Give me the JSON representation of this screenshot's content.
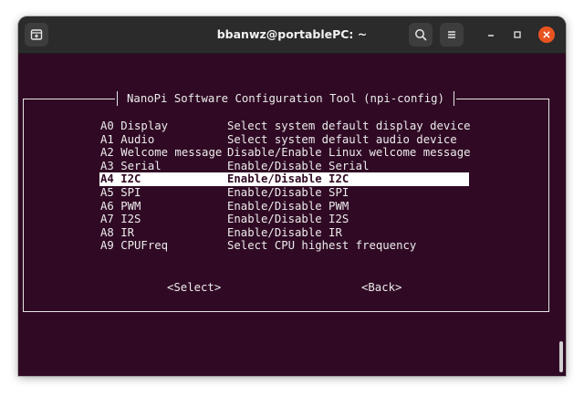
{
  "window": {
    "title": "bbanwz@portablePC: ~"
  },
  "titlebar": {
    "new_tab_icon": "new-tab-icon",
    "search_icon": "search-icon",
    "menu_icon": "hamburger-menu-icon",
    "minimize_icon": "minimize-icon",
    "maximize_icon": "maximize-icon",
    "close_icon": "close-icon"
  },
  "dialog": {
    "title": "NanoPi Software Configuration Tool (npi-config)",
    "items": [
      {
        "key": "A0 Display",
        "desc": "Select system default display device"
      },
      {
        "key": "A1 Audio",
        "desc": "Select system default audio device"
      },
      {
        "key": "A2 Welcome message",
        "desc": "Disable/Enable Linux welcome message"
      },
      {
        "key": "A3 Serial",
        "desc": "Enable/Disable Serial"
      },
      {
        "key": "A4 I2C",
        "desc": "Enable/Disable I2C"
      },
      {
        "key": "A5 SPI",
        "desc": "Enable/Disable SPI"
      },
      {
        "key": "A6 PWM",
        "desc": "Enable/Disable PWM"
      },
      {
        "key": "A7 I2S",
        "desc": "Enable/Disable I2S"
      },
      {
        "key": "A8 IR",
        "desc": "Enable/Disable IR"
      },
      {
        "key": "A9 CPUFreq",
        "desc": "Select CPU highest frequency"
      }
    ],
    "select_label": "<Select>",
    "back_label": "<Back>"
  },
  "colors": {
    "terminal_bg": "#300a24",
    "terminal_fg": "#ececec",
    "close_button": "#e95420",
    "titlebar_bg": "#2b2b2b"
  }
}
